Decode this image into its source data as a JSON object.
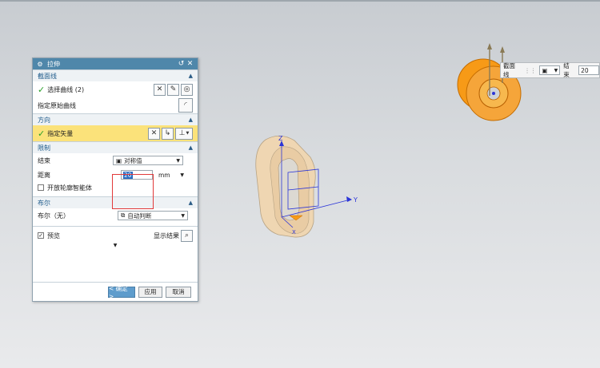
{
  "dialog": {
    "title": "拉伸",
    "sections": {
      "section_curve": {
        "header": "截面线",
        "select_curve": "选择曲线 (2)",
        "specify_origin_curve": "指定原始曲线"
      },
      "direction": {
        "header": "方向",
        "specify_vector": "指定矢量"
      },
      "limits": {
        "header": "限制",
        "end_label": "结束",
        "end_value": "对称值",
        "distance_label": "距离",
        "distance_value": "20",
        "distance_unit": "mm",
        "open_profile_label": "开放轮廓智能体"
      },
      "boolean": {
        "header": "布尔",
        "boolean_label": "布尔（无）",
        "boolean_value": "自动判断"
      }
    },
    "preview_label": "预览",
    "show_result_label": "显示结果",
    "ok_label": "< 确定 >",
    "apply_label": "应用",
    "cancel_label": "取消"
  },
  "viewport": {
    "axis_x": "X",
    "axis_y": "Y",
    "axis_z": "Z"
  },
  "minibar": {
    "section_label": "截面线",
    "end_label": "结束",
    "end_value": "20"
  },
  "colors": {
    "title_bar": "#4f87aa",
    "highlight_row": "#fbe27a",
    "solid_beige": "#efd6b2",
    "solid_orange": "#f79a17",
    "axis_blue": "#2b35d8",
    "red_box": "#e23a3a"
  }
}
